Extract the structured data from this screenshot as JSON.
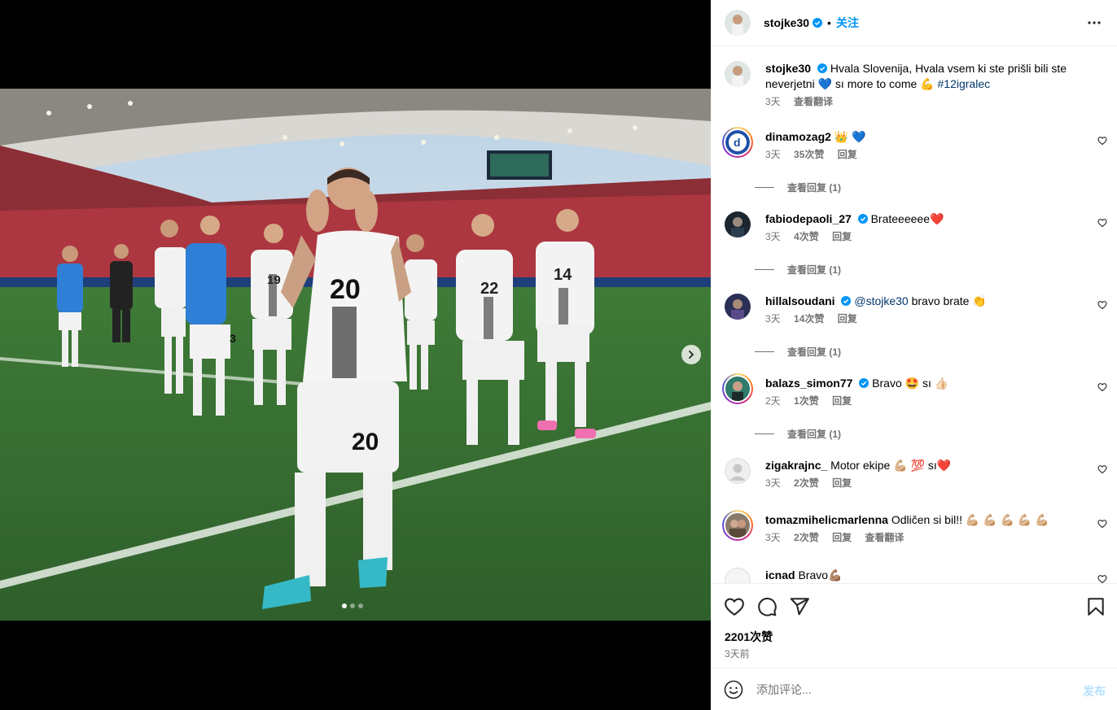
{
  "post": {
    "username": "stojke30",
    "follow_label": "关注",
    "separator": "•",
    "caption_text": "Hvala Slovenija, Hvala vsem ki ste prišli bili ste neverjetni 💙 sı more to come 💪",
    "caption_hashtag": "#12igralec",
    "caption_time": "3天",
    "caption_translate": "查看翻译",
    "likes": "2201次赞",
    "posted_time": "3天前",
    "comment_placeholder": "添加评论...",
    "post_label": "发布"
  },
  "comments": [
    {
      "user": "dinamozag2",
      "text": "👑 💙",
      "time": "3天",
      "likes": "35次赞",
      "reply": "回复",
      "view_replies": "查看回复 (1)"
    },
    {
      "user": "fabiodepaoli_27",
      "verified": true,
      "text": "Brateeeeee❤️",
      "time": "3天",
      "likes": "4次赞",
      "reply": "回复",
      "view_replies": "查看回复 (1)"
    },
    {
      "user": "hillalsoudani",
      "verified": true,
      "mention": "@stojke30",
      "text": "bravo brate 👏",
      "time": "3天",
      "likes": "14次赞",
      "reply": "回复",
      "view_replies": "查看回复 (1)"
    },
    {
      "user": "balazs_simon77",
      "verified": true,
      "text": "Bravo 🤩 sı 👍🏻",
      "time": "2天",
      "likes": "1次赞",
      "reply": "回复",
      "view_replies": "查看回复 (1)"
    },
    {
      "user": "zigakrajnc_",
      "text": "Motor ekipe 💪🏼 💯 sı❤️",
      "time": "3天",
      "likes": "2次赞",
      "reply": "回复"
    },
    {
      "user": "tomazmihelicmarlenna",
      "text": "Odličen si bil!! 💪🏼 💪🏼 💪🏼 💪🏼 💪🏼",
      "time": "3天",
      "likes": "2次赞",
      "reply": "回复",
      "translate": "查看翻译"
    },
    {
      "user": "icnad",
      "text": "Bravo💪🏽"
    }
  ],
  "carousel": {
    "count": 3,
    "active": 1
  },
  "photo": {
    "numbers": [
      "20",
      "22",
      "14",
      "19",
      "20"
    ]
  },
  "colors": {
    "accent": "#0095f6",
    "link": "#00376b",
    "muted": "#737373",
    "verified": "#0095f6"
  },
  "icons": [
    "more-options-icon",
    "heart-icon",
    "comment-icon",
    "share-icon",
    "bookmark-icon",
    "emoji-icon",
    "chevron-right-icon",
    "verified-icon"
  ]
}
